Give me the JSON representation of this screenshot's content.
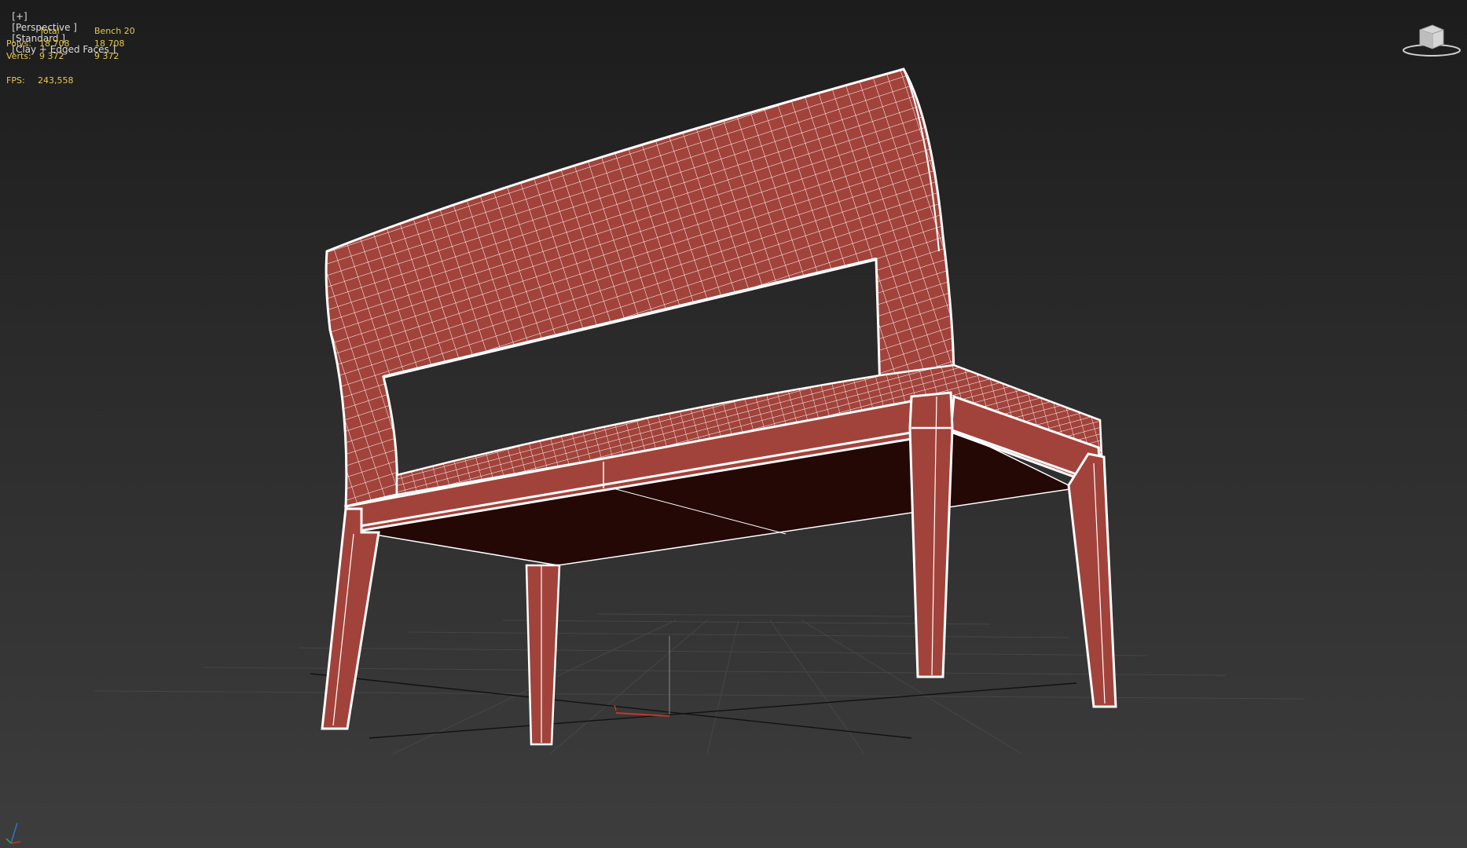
{
  "viewport": {
    "label_parts": [
      "[+]",
      "[Perspective ]",
      "[Standard ]",
      "[Clay + Edged Faces ]"
    ]
  },
  "stats": {
    "col_total": "Total",
    "col_object": "Bench 20",
    "polys_label": "Polys:",
    "polys_total": "18 708",
    "polys_object": "18 708",
    "verts_label": "Verts:",
    "verts_total": "9 372",
    "verts_object": "9 372",
    "fps_label": "FPS:",
    "fps_value": "243,558"
  },
  "colors": {
    "stats_text": "#e8c84a",
    "clay": "#a2433b",
    "wire": "#ffffff",
    "underside": "#230806",
    "background": "#2e2e2e"
  },
  "icons": {
    "viewcube": "viewcube-icon",
    "axis": "axis-tripod-icon",
    "pivot": "pivot-gizmo-icon"
  }
}
